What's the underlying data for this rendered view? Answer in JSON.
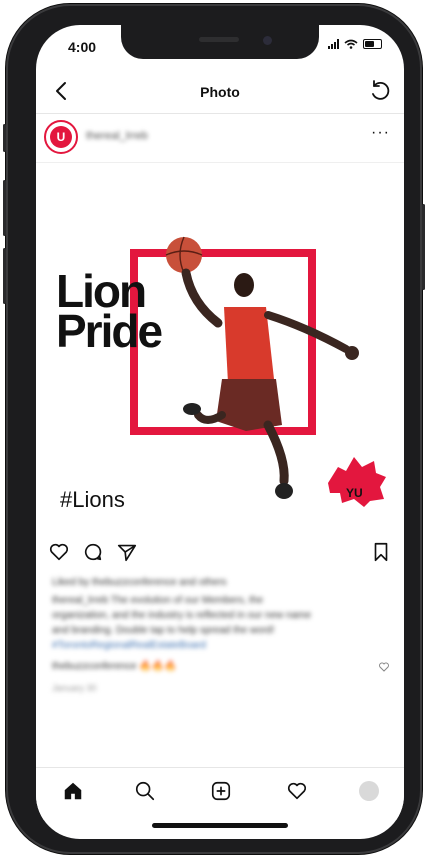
{
  "status_bar": {
    "time": "4:00"
  },
  "nav": {
    "title": "Photo"
  },
  "post": {
    "avatar_letter": "U",
    "username": "thereal_lrreb",
    "more_label": "···",
    "headline_line1": "Lion",
    "headline_line2": "Pride",
    "hashtag": "#Lions",
    "logo_text": "YU",
    "liked_by": "Liked by thebuzzconference and others",
    "caption_line1": "thereal_lrreb The evolution of our Members, the",
    "caption_line2": "organization, and the industry is reflected in our new name",
    "caption_line3": "and branding. Double tap to help spread the word!",
    "caption_tags": "#TorontoRegionalRealEstateBoard",
    "comment": "thebuzzconference 🔥🔥🔥",
    "date": "January 30"
  },
  "colors": {
    "accent": "#e3173e",
    "text": "#111111",
    "frame": "#1c1c1e"
  },
  "icons": [
    "back-icon",
    "refresh-icon",
    "heart-icon",
    "comment-icon",
    "share-icon",
    "bookmark-icon",
    "home-icon",
    "search-icon",
    "add-icon",
    "activity-icon",
    "profile-icon"
  ]
}
